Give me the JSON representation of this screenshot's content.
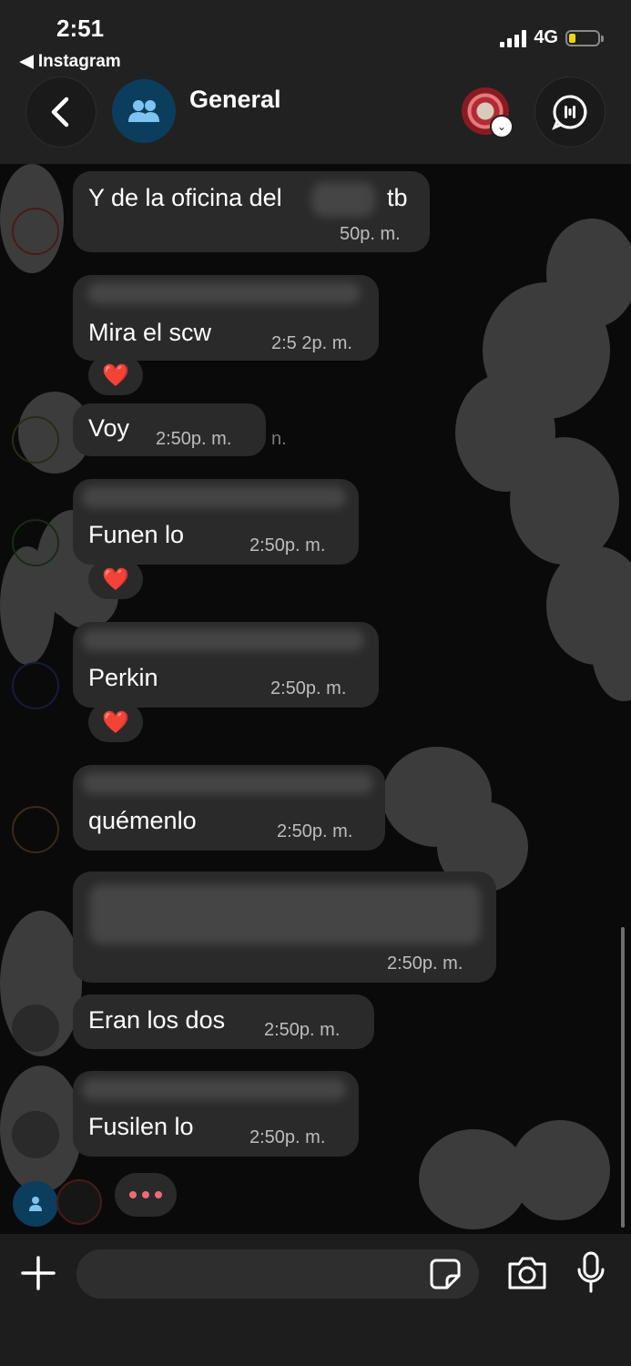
{
  "status_bar": {
    "time": "2:51",
    "back_app": "◀ Instagram",
    "network": "4G",
    "battery_level": 0.22
  },
  "header": {
    "title": "General"
  },
  "messages": [
    {
      "text": "Y de la oficina del",
      "suffix": "tb",
      "time": "50p. m."
    },
    {
      "text": "Mira el scw",
      "time": "2:5 2p. m.",
      "reaction": "❤️"
    },
    {
      "text": "Voy",
      "time": "2:50p. m.",
      "time_ghost": "n."
    },
    {
      "text": "Funen lo",
      "time": "2:50p. m.",
      "reaction": "❤️"
    },
    {
      "text": "Perkin",
      "time": "2:50p. m.",
      "reaction": "❤️"
    },
    {
      "text": "quémenlo",
      "time": "2:50p. m."
    },
    {
      "text": "",
      "time": "2:50p. m."
    },
    {
      "text": "Eran los dos",
      "time": "2:50p. m."
    },
    {
      "text": "Fusilen lo",
      "time": "2:50p. m."
    }
  ],
  "colors": {
    "accent_blue": "#0b3d5c",
    "bubble": "#2a2a2a",
    "typing_dots": "#ef6a78"
  },
  "icons": [
    "back-chevron-icon",
    "group-icon",
    "call-icon",
    "plus-icon",
    "sticker-icon",
    "camera-icon",
    "mic-icon"
  ]
}
